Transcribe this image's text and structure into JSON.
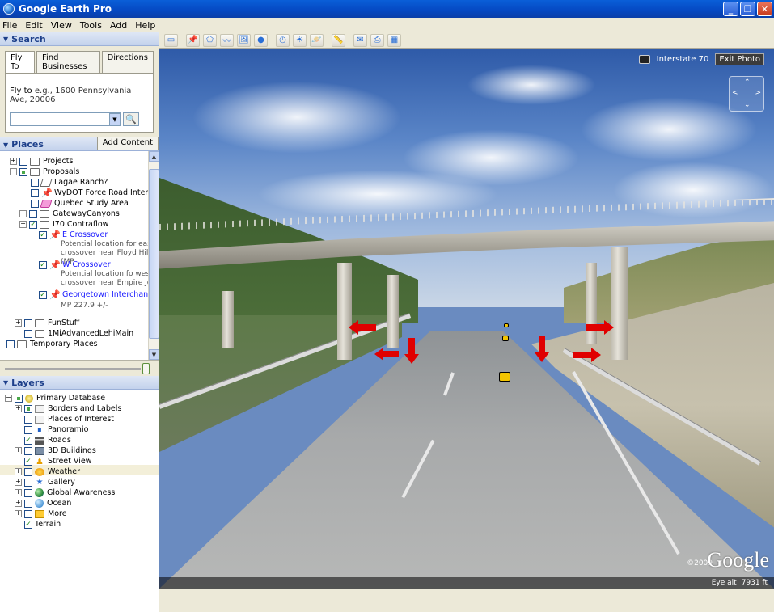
{
  "window": {
    "title": "Google Earth Pro",
    "controls": [
      "_",
      "❐",
      "✕"
    ]
  },
  "menu": [
    "File",
    "Edit",
    "View",
    "Tools",
    "Add",
    "Help"
  ],
  "search": {
    "header": "Search",
    "tabs": [
      "Fly To",
      "Find Businesses",
      "Directions"
    ],
    "hint_label": "Fly to",
    "hint": "e.g., 1600 Pennsylvania Ave, 20006",
    "input_value": ""
  },
  "places": {
    "header": "Places",
    "add_content": "Add Content",
    "items": [
      {
        "label": "Projects"
      },
      {
        "label": "Proposals"
      },
      {
        "label": "Lagae Ranch?"
      },
      {
        "label": "WyDOT Force Road Interch..."
      },
      {
        "label": "Quebec Study Area"
      },
      {
        "label": "GatewayCanyons"
      },
      {
        "label": "I70 Contraflow"
      },
      {
        "label": "E Crossover",
        "desc": [
          "Potential location for east",
          "crossover near Floyd Hill (MP"
        ]
      },
      {
        "label": "W Crossover",
        "desc": [
          "Potential location fo west",
          "crossover near Empire Jct"
        ]
      },
      {
        "label": "Georgetown Interchange",
        "desc": [
          "MP 227.9 +/-"
        ]
      },
      {
        "label": "FunStuff"
      },
      {
        "label": "1MiAdvancedLehiMain"
      },
      {
        "label": "Temporary Places"
      }
    ]
  },
  "layers": {
    "header": "Layers",
    "items": [
      {
        "label": "Primary Database"
      },
      {
        "label": "Borders and Labels"
      },
      {
        "label": "Places of Interest"
      },
      {
        "label": "Panoramio"
      },
      {
        "label": "Roads"
      },
      {
        "label": "3D Buildings"
      },
      {
        "label": "Street View"
      },
      {
        "label": "Weather"
      },
      {
        "label": "Gallery"
      },
      {
        "label": "Global Awareness"
      },
      {
        "label": "Ocean"
      },
      {
        "label": "More"
      },
      {
        "label": "Terrain"
      }
    ]
  },
  "viewport": {
    "location_label": "Interstate 70",
    "exit_photo": "Exit Photo",
    "logo": "Google",
    "copyright": "©2009",
    "eye_alt_label": "Eye alt",
    "eye_alt_value": "7931 ft"
  },
  "colors": {
    "arrow": "#e00000",
    "title_bar": "#0548c2",
    "link": "#1a1aff"
  }
}
